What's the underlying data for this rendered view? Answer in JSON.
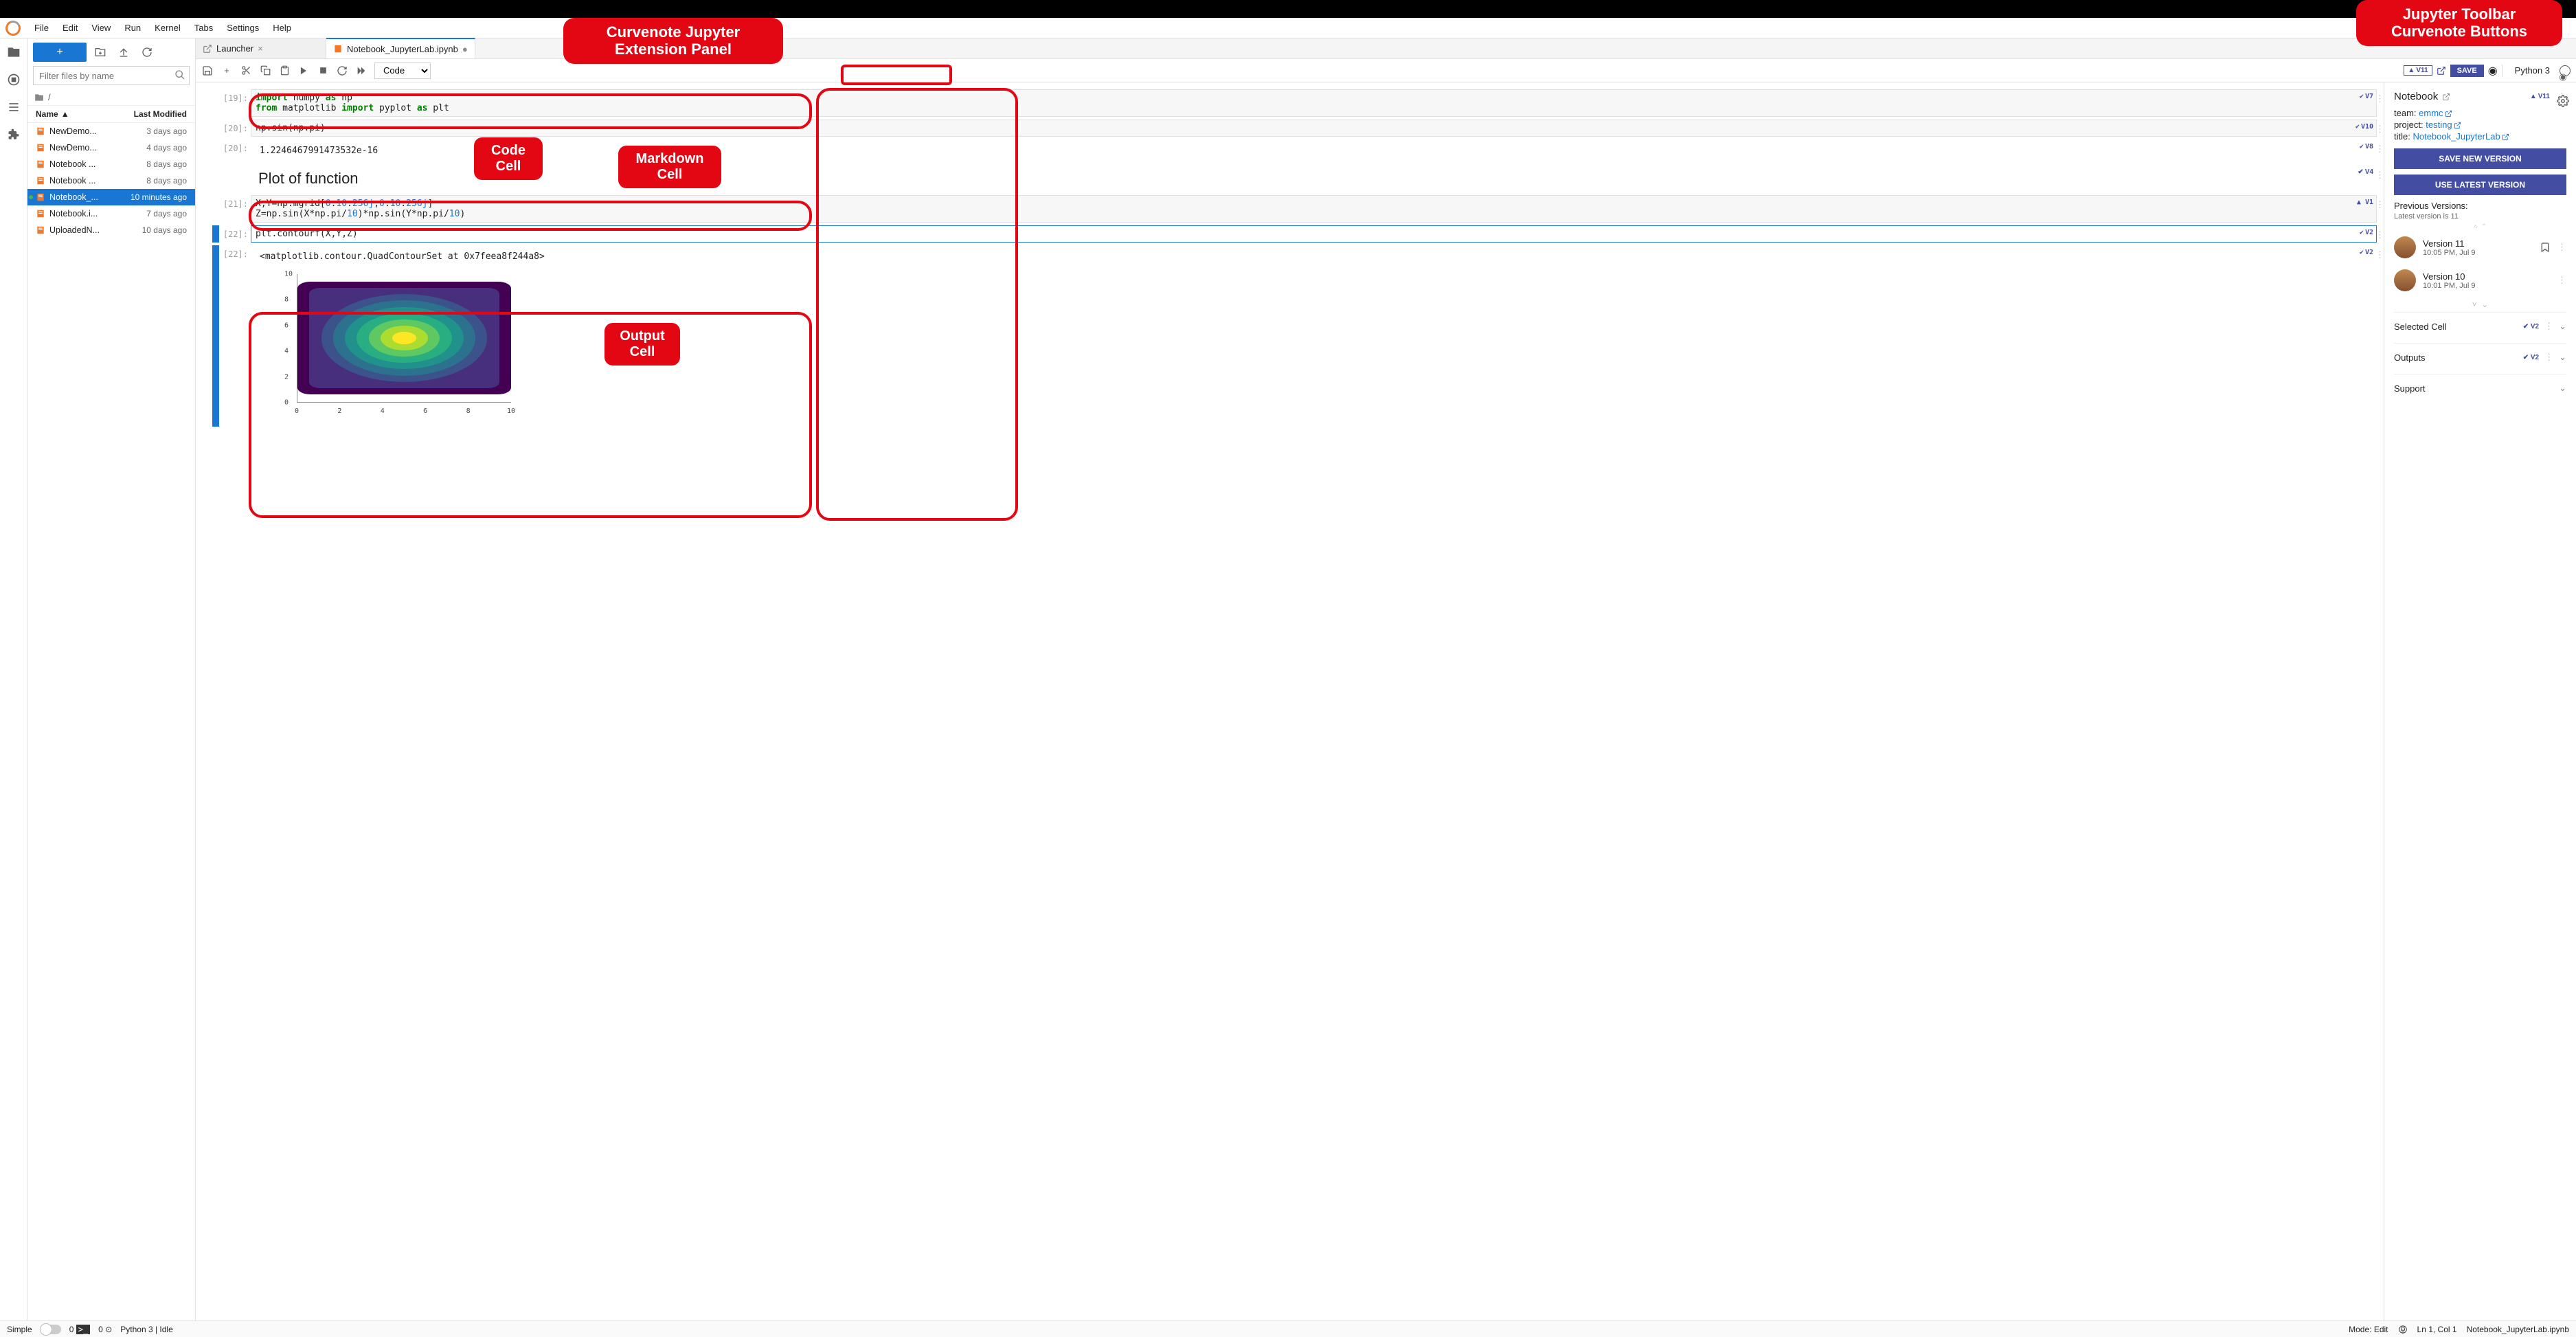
{
  "menus": [
    "File",
    "Edit",
    "View",
    "Run",
    "Kernel",
    "Tabs",
    "Settings",
    "Help"
  ],
  "sidebar": {
    "filter_placeholder": "Filter files by name",
    "breadcrumb": "/",
    "headers": {
      "name": "Name",
      "modified": "Last Modified"
    },
    "files": [
      {
        "name": "NewDemo...",
        "modified": "3 days ago",
        "selected": false,
        "running": false
      },
      {
        "name": "NewDemo...",
        "modified": "4 days ago",
        "selected": false,
        "running": false
      },
      {
        "name": "Notebook ...",
        "modified": "8 days ago",
        "selected": false,
        "running": false
      },
      {
        "name": "Notebook ...",
        "modified": "8 days ago",
        "selected": false,
        "running": false
      },
      {
        "name": "Notebook_...",
        "modified": "10 minutes ago",
        "selected": true,
        "running": true
      },
      {
        "name": "Notebook.i...",
        "modified": "7 days ago",
        "selected": false,
        "running": false
      },
      {
        "name": "UploadedN...",
        "modified": "10 days ago",
        "selected": false,
        "running": false
      }
    ]
  },
  "tabs": [
    {
      "label": "Launcher",
      "active": false,
      "icon": "launch"
    },
    {
      "label": "Notebook_JupyterLab.ipynb",
      "active": true,
      "icon": "nb",
      "dirty": true
    }
  ],
  "toolbar": {
    "cell_type": "Code",
    "version_chip": "V11",
    "save_label": "SAVE",
    "kernel": "Python 3"
  },
  "cells": [
    {
      "type": "code",
      "prompt": "[19]:",
      "version": "V7",
      "content_html": "<span class='kw'>import</span> numpy <span class='kw'>as</span> np<br><span class='kw'>from</span> matplotlib <span class='kw'>import</span> pyplot <span class='kw'>as</span> plt"
    },
    {
      "type": "code",
      "prompt": "[20]:",
      "version": "V10",
      "content_html": "np.sin(np.pi)"
    },
    {
      "type": "output",
      "prompt": "[20]:",
      "version": "V8",
      "content_text": "1.2246467991473532e-16"
    },
    {
      "type": "markdown",
      "prompt": "",
      "version": "V4",
      "content_text": "Plot of function"
    },
    {
      "type": "code",
      "prompt": "[21]:",
      "version": "V1",
      "version_icon": "up",
      "content_html": "X,Y=np.mgrid[<span class='num'>0</span>:<span class='num'>10</span>:<span class='num'>256j</span>,<span class='num'>0</span>:<span class='num'>10</span>:<span class='num'>256j</span>]<br>Z=np.sin(X*np.pi/<span class='num'>10</span>)*np.sin(Y*np.pi/<span class='num'>10</span>)"
    },
    {
      "type": "code",
      "prompt": "[22]:",
      "version": "V2",
      "selected": true,
      "focused": true,
      "content_html": "plt.contourf(X,Y,Z)"
    },
    {
      "type": "output",
      "prompt": "[22]:",
      "version": "V2",
      "selected": true,
      "content_text": "<matplotlib.contour.QuadContourSet at 0x7feea8f244a8>",
      "has_plot": true
    }
  ],
  "chart_data": {
    "type": "contour",
    "title": "",
    "xlim": [
      0,
      10
    ],
    "ylim": [
      0,
      10
    ],
    "x_ticks": [
      0,
      2,
      4,
      6,
      8,
      10
    ],
    "y_ticks": [
      0,
      2,
      4,
      6,
      8,
      10
    ],
    "note": "Z = sin(X*pi/10)*sin(Y*pi/10); filled contour, viridis-like colormap, peak at center ~ (5,5)"
  },
  "right_panel": {
    "title": "Notebook",
    "version": "V11",
    "team_label": "team:",
    "team": "emmc",
    "project_label": "project:",
    "project": "testing",
    "title_label": "title:",
    "notebook_title": "Notebook_JupyterLab",
    "save_btn": "SAVE NEW VERSION",
    "use_btn": "USE LATEST VERSION",
    "prev_label": "Previous Versions:",
    "latest_note": "Latest version is 11",
    "versions": [
      {
        "label": "Version 11",
        "time": "10:05 PM, Jul 9",
        "bookmark": true
      },
      {
        "label": "Version 10",
        "time": "10:01 PM, Jul 9",
        "bookmark": false
      }
    ],
    "sections": [
      {
        "title": "Selected Cell",
        "badge": "V2"
      },
      {
        "title": "Outputs",
        "badge": "V2"
      },
      {
        "title": "Support",
        "badge": ""
      }
    ]
  },
  "callouts": {
    "top1": "Curvenote Jupyter\nExtension Panel",
    "top2": "Jupyter Toolbar\nCurvenote Buttons",
    "code": "Code\nCell",
    "md": "Markdown\nCell",
    "out": "Output\nCell"
  },
  "statusbar": {
    "simple": "Simple",
    "terminals": "0",
    "kernels": "0",
    "kernel_status": "Python 3 | Idle",
    "mode": "Mode: Edit",
    "pos": "Ln 1, Col 1",
    "file": "Notebook_JupyterLab.ipynb"
  }
}
